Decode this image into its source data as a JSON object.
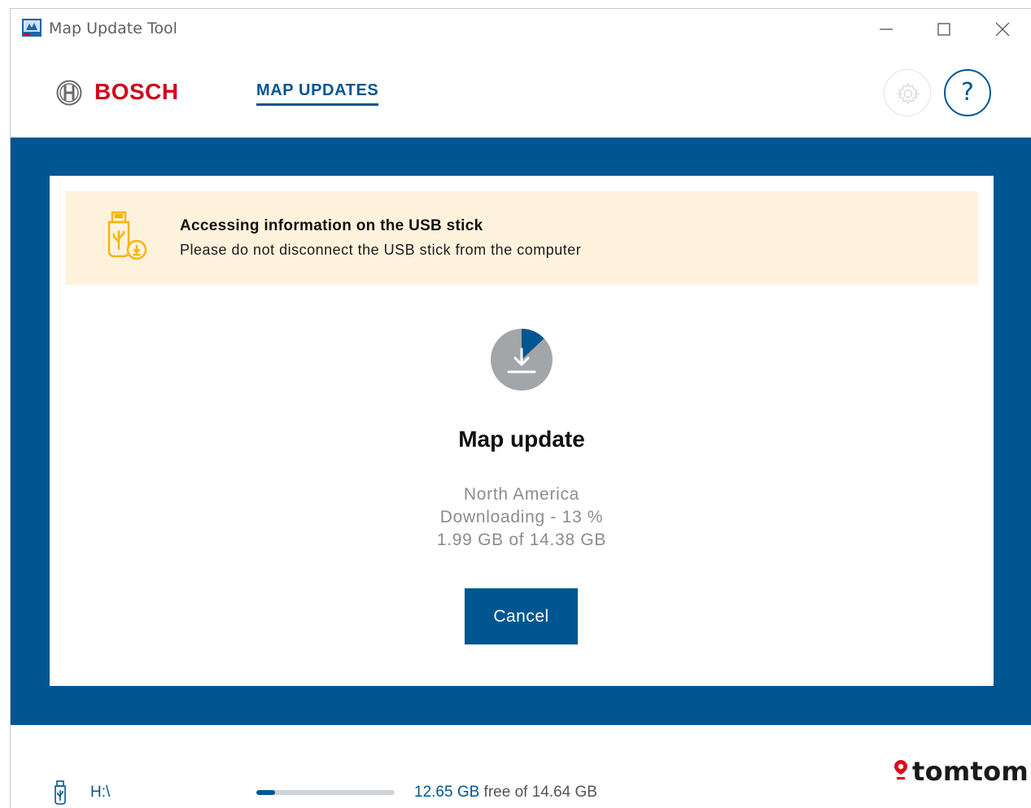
{
  "window": {
    "title": "Map Update Tool"
  },
  "header": {
    "brand": "BOSCH",
    "nav_tab": "MAP UPDATES",
    "help_label": "?"
  },
  "banner": {
    "title": "Accessing information on the USB stick",
    "subtitle": "Please do not disconnect the USB stick from the computer"
  },
  "update": {
    "title": "Map update",
    "region": "North America",
    "status": "Downloading - 13 %",
    "size": "1.99 GB of 14.38 GB",
    "progress_fraction": 0.13,
    "cancel_label": "Cancel"
  },
  "footer": {
    "drive": "H:\\",
    "free_amount": "12.65 GB",
    "free_rest": " free of 14.64 GB",
    "used_fraction": 0.136,
    "partner_brand": "tomtom"
  },
  "colors": {
    "brand_blue": "#005691",
    "bosch_red": "#d0021b",
    "warning_bg": "#fff2dd",
    "warning_icon": "#f5b400"
  },
  "icons": {
    "app": "map-update-app-icon",
    "settings": "gear-icon",
    "usb_warning": "usb-stick-warning-icon",
    "progress": "download-progress-icon",
    "usb": "usb-stick-icon",
    "partner": "location-pin-icon"
  }
}
